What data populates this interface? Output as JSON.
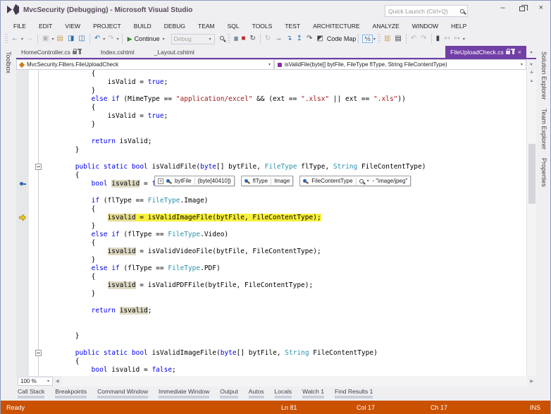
{
  "window": {
    "title": "MvcSecurity (Debugging) - Microsoft Visual Studio"
  },
  "title_bar": {
    "quick_launch_placeholder": "Quick Launch (Ctrl+Q)"
  },
  "menu": {
    "items": [
      "FILE",
      "EDIT",
      "VIEW",
      "PROJECT",
      "BUILD",
      "DEBUG",
      "TEAM",
      "SQL",
      "TOOLS",
      "TEST",
      "ARCHITECTURE",
      "ANALYZE",
      "WINDOW",
      "HELP"
    ]
  },
  "icons": {
    "back": "←",
    "forward": "→",
    "caret": "▾",
    "window_new": "▣",
    "open_folder": "▤",
    "save": "◨",
    "save_all": "◫",
    "undo": "↶",
    "redo": "↷",
    "play": "▶",
    "pause": "▮▮",
    "stop": "■",
    "restart": "↻",
    "show_next": "→",
    "step_into": "↴",
    "step_out": "↥",
    "step_over": "↷",
    "code_map": "◩",
    "intellitrace": "⅍",
    "new_folder": "▥",
    "doc_copy": "▤",
    "nav_back": "↶",
    "nav_fwd": "↷",
    "bookmark": "▮",
    "prev_bookmark": "↤",
    "next_bookmark": "↦",
    "up": "▲",
    "left": "◀",
    "right": "▶",
    "minimize": "–",
    "close": "×",
    "expand_plus": "+",
    "collapse_minus": "−"
  },
  "toolbar": {
    "continue_label": "Continue",
    "debug_label": "Debug",
    "codemap_label": "Code Map"
  },
  "tabs": {
    "items": [
      {
        "label": "HomeController.cs"
      },
      {
        "label": "Index.cshtml"
      },
      {
        "label": "_Layout.cshtml"
      },
      {
        "label": "FileUploadCheck.cs"
      }
    ]
  },
  "navbar": {
    "left": "MvcSecurity.Filters.FileUploadCheck",
    "right": "isValidFile(byte[] bytFile, FileType flType, String FileContentType)"
  },
  "editor": {
    "zoom": "100 %",
    "current_line": 17,
    "pin_line": 13,
    "collapse_lines": [
      11,
      33
    ],
    "datatips": [
      {
        "name": "bytFile",
        "value": "{byte[40410]}"
      },
      {
        "name": "flType",
        "value": "Image"
      },
      {
        "name": "FileContentType",
        "value": "- \"image/jpeg\""
      }
    ],
    "lines": [
      [
        [
          "p",
          "            {"
        ]
      ],
      [
        [
          "p",
          "                isValid = "
        ],
        [
          "k",
          "true"
        ],
        [
          "p",
          ";"
        ]
      ],
      [
        [
          "p",
          "            }"
        ]
      ],
      [
        [
          "k",
          "            else"
        ],
        [
          "p",
          " "
        ],
        [
          "k",
          "if"
        ],
        [
          "p",
          " (MimeType == "
        ],
        [
          "s",
          "\"application/excel\""
        ],
        [
          "p",
          " && (ext == "
        ],
        [
          "s",
          "\".xlsx\""
        ],
        [
          "p",
          " || ext == "
        ],
        [
          "s",
          "\".xls\""
        ],
        [
          "p",
          "))"
        ]
      ],
      [
        [
          "p",
          "            {"
        ]
      ],
      [
        [
          "p",
          "                isValid = "
        ],
        [
          "k",
          "true"
        ],
        [
          "p",
          ";"
        ]
      ],
      [
        [
          "p",
          "            }"
        ]
      ],
      [],
      [
        [
          "k",
          "            return"
        ],
        [
          "p",
          " isValid;"
        ]
      ],
      [
        [
          "p",
          "        }"
        ]
      ],
      [],
      [
        [
          "k",
          "        public"
        ],
        [
          "p",
          " "
        ],
        [
          "k",
          "static"
        ],
        [
          "p",
          " "
        ],
        [
          "k",
          "bool"
        ],
        [
          "p",
          " isValidFile("
        ],
        [
          "k",
          "byte"
        ],
        [
          "p",
          "[] bytFile, "
        ],
        [
          "t",
          "FileType"
        ],
        [
          "p",
          " flType, "
        ],
        [
          "t",
          "String"
        ],
        [
          "p",
          " FileContentType)"
        ]
      ],
      [
        [
          "p",
          "        {"
        ]
      ],
      [
        [
          "k",
          "            bool"
        ],
        [
          "p",
          " "
        ],
        [
          "h",
          "isvalid"
        ],
        [
          "p",
          " = "
        ],
        [
          "k",
          "false"
        ],
        [
          "p",
          ";"
        ]
      ],
      [],
      [
        [
          "k",
          "            if"
        ],
        [
          "p",
          " (flType == "
        ],
        [
          "t",
          "FileType"
        ],
        [
          "p",
          ".Image)"
        ]
      ],
      [
        [
          "p",
          "            {"
        ]
      ],
      [
        [
          "p",
          "                "
        ],
        [
          "yh",
          "isvalid"
        ],
        [
          "y",
          " = isValidImageFile(bytFile, FileContentType);"
        ]
      ],
      [
        [
          "p",
          "            }"
        ]
      ],
      [
        [
          "k",
          "            else"
        ],
        [
          "p",
          " "
        ],
        [
          "k",
          "if"
        ],
        [
          "p",
          " (flType == "
        ],
        [
          "t",
          "FileType"
        ],
        [
          "p",
          ".Video)"
        ]
      ],
      [
        [
          "p",
          "            {"
        ]
      ],
      [
        [
          "p",
          "                "
        ],
        [
          "h",
          "isvalid"
        ],
        [
          "p",
          " = isValidVideoFile(bytFile, FileContentType);"
        ]
      ],
      [
        [
          "p",
          "            }"
        ]
      ],
      [
        [
          "k",
          "            else"
        ],
        [
          "p",
          " "
        ],
        [
          "k",
          "if"
        ],
        [
          "p",
          " (flType == "
        ],
        [
          "t",
          "FileType"
        ],
        [
          "p",
          ".PDF)"
        ]
      ],
      [
        [
          "p",
          "            {"
        ]
      ],
      [
        [
          "p",
          "                "
        ],
        [
          "h",
          "isvalid"
        ],
        [
          "p",
          " = isValidPDFFile(bytFile, FileContentType);"
        ]
      ],
      [
        [
          "p",
          "            }"
        ]
      ],
      [],
      [
        [
          "k",
          "            return"
        ],
        [
          "p",
          " "
        ],
        [
          "h",
          "isvalid"
        ],
        [
          "p",
          ";"
        ]
      ],
      [],
      [],
      [
        [
          "p",
          "        }"
        ]
      ],
      [],
      [
        [
          "k",
          "        public"
        ],
        [
          "p",
          " "
        ],
        [
          "k",
          "static"
        ],
        [
          "p",
          " "
        ],
        [
          "k",
          "bool"
        ],
        [
          "p",
          " isValidImageFile("
        ],
        [
          "k",
          "byte"
        ],
        [
          "p",
          "[] bytFile, "
        ],
        [
          "t",
          "String"
        ],
        [
          "p",
          " FileContentType)"
        ]
      ],
      [
        [
          "p",
          "        {"
        ]
      ],
      [
        [
          "k",
          "            bool"
        ],
        [
          "p",
          " isvalid = "
        ],
        [
          "k",
          "false"
        ],
        [
          "p",
          ";"
        ]
      ]
    ]
  },
  "side_tabs": {
    "left": [
      "Toolbox"
    ],
    "right": [
      "Solution Explorer",
      "Team Explorer",
      "Properties"
    ]
  },
  "bottom_tabs": {
    "items": [
      "Call Stack",
      "Breakpoints",
      "Command Window",
      "Immediate Window",
      "Output",
      "Autos",
      "Locals",
      "Watch 1",
      "Find Results 1"
    ]
  },
  "status_bar": {
    "state": "Ready",
    "line": "Ln 81",
    "col": "Col 17",
    "ch": "Ch 17",
    "mode": "INS"
  },
  "colors": {
    "accent_purple": "#713FA5",
    "status_orange": "#CA5100",
    "current_statement_yellow": "#F8F13C",
    "symbol_highlight": "#DFDAC4"
  }
}
